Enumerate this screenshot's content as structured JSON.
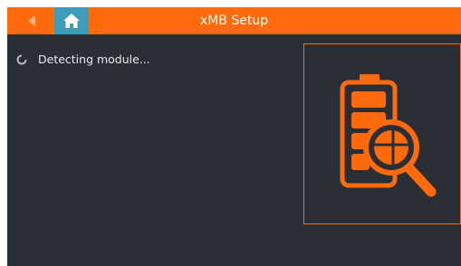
{
  "header": {
    "title": "xMB Setup",
    "back_icon": "back-arrow-icon",
    "home_icon": "home-icon"
  },
  "status": {
    "text": "Detecting module...",
    "icon": "loading-spinner-icon"
  },
  "illustration": {
    "icon": "battery-search-icon"
  },
  "colors": {
    "accent": "#FF6A0D",
    "home_button": "#3E9BBA",
    "background": "#2A2F36",
    "text": "#E8E8E8"
  }
}
